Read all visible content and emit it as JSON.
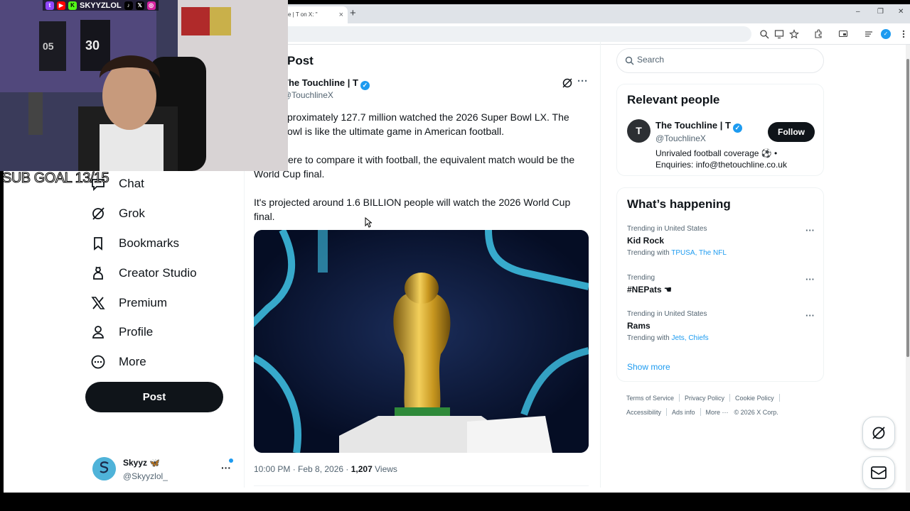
{
  "browser": {
    "tab_title": "e | T on X: \"",
    "tab_close": "×",
    "new_tab": "+",
    "minimize": "–",
    "restore": "❐",
    "close": "✕"
  },
  "nav": {
    "items": [
      {
        "label": "Chat",
        "icon": "chat-icon"
      },
      {
        "label": "Grok",
        "icon": "grok-icon"
      },
      {
        "label": "Bookmarks",
        "icon": "bookmark-icon"
      },
      {
        "label": "Creator Studio",
        "icon": "creator-studio-icon"
      },
      {
        "label": "Premium",
        "icon": "x-logo-icon"
      },
      {
        "label": "Profile",
        "icon": "person-icon"
      },
      {
        "label": "More",
        "icon": "more-circle-icon"
      }
    ],
    "post_label": "Post"
  },
  "account": {
    "name": "Skyyz 🦋",
    "handle": "@Skyyzlol_",
    "more": "···"
  },
  "tweet": {
    "header": "Post",
    "author_name": "The Touchline | T",
    "author_handle": "@TouchlineX",
    "more": "···",
    "text_lines": [
      "proximately 127.7 million watched the 2026 Super Bowl LX. The",
      "owl is like the ultimate game in American football.",
      "ere to compare it with football, the equivalent match would be the",
      "World Cup final.",
      "It's projected around 1.6 BILLION people will watch the 2026 World Cup",
      "final."
    ],
    "time": "10:00 PM · Feb 8, 2026 · ",
    "views_count": "1,207",
    "views_label": " Views"
  },
  "search": {
    "placeholder": "Search"
  },
  "relevant_people": {
    "title": "Relevant people",
    "name": "The Touchline | T",
    "handle": "@TouchlineX",
    "avatar_letter": "T",
    "follow_label": "Follow",
    "bio_line1": "Unrivaled football coverage ⚽ •",
    "bio_line2": "Enquiries: info@thetouchline.co.uk"
  },
  "trends": {
    "title": "What’s happening",
    "items": [
      {
        "category": "Trending in United States",
        "name": "Kid Rock",
        "with_prefix": "Trending with ",
        "with_links": "TPUSA, The NFL"
      },
      {
        "category": "Trending",
        "name": "#NEPats ☚",
        "with_prefix": "",
        "with_links": ""
      },
      {
        "category": "Trending in United States",
        "name": "Rams",
        "with_prefix": "Trending with ",
        "with_links": "Jets, Chiefs"
      }
    ],
    "more": "···",
    "show_more": "Show more"
  },
  "footer": {
    "row1": [
      "Terms of Service",
      "Privacy Policy",
      "Cookie Policy"
    ],
    "row2": [
      "Accessibility",
      "Ads info",
      "More ···",
      "© 2026 X Corp."
    ]
  },
  "webcam": {
    "channel": "SKYYZLOL",
    "sub_goal": "SUB GOAL 13/15"
  },
  "colors": {
    "accent": "#1d9bf0",
    "text": "#0f1419",
    "muted": "#536471"
  }
}
